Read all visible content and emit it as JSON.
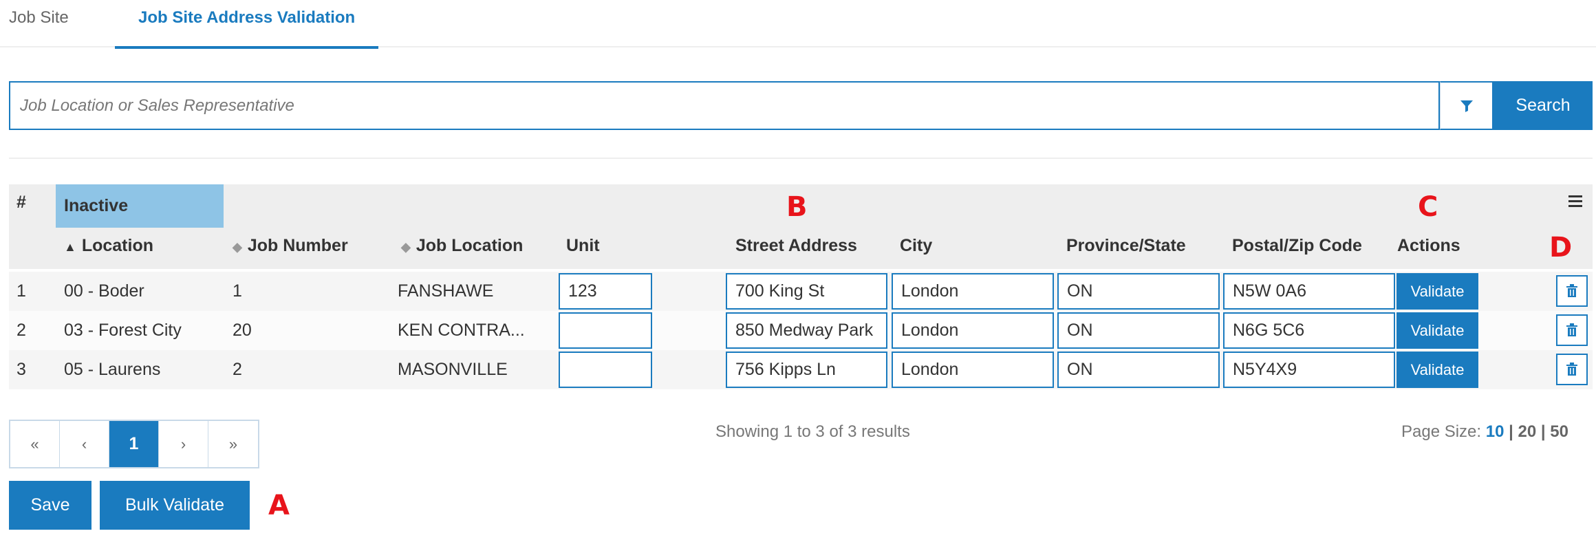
{
  "tabs": [
    {
      "label": "Job Site"
    },
    {
      "label": "Job Site Address Validation"
    }
  ],
  "search": {
    "placeholder": "Job Location or Sales Representative",
    "button_label": "Search",
    "filter_icon": "filter-icon"
  },
  "table": {
    "hash_label": "#",
    "group_label": "Inactive",
    "menu_icon": "hamburger-menu-icon",
    "headers": {
      "location": "Location",
      "job_number": "Job Number",
      "job_location": "Job Location",
      "unit": "Unit",
      "street_address": "Street Address",
      "city": "City",
      "province_state": "Province/State",
      "postal_zip": "Postal/Zip Code",
      "actions": "Actions"
    },
    "rows": [
      {
        "num": "1",
        "location": "00 - Boder",
        "job_number": "1",
        "job_location": "FANSHAWE",
        "unit": "123",
        "street_address": "700 King St",
        "city": "London",
        "province_state": "ON",
        "postal_zip": "N5W 0A6",
        "action_label": "Validate"
      },
      {
        "num": "2",
        "location": "03 - Forest City",
        "job_number": "20",
        "job_location": "KEN CONTRA...",
        "unit": "",
        "street_address": "850 Medway Park",
        "city": "London",
        "province_state": "ON",
        "postal_zip": "N6G 5C6",
        "action_label": "Validate"
      },
      {
        "num": "3",
        "location": "05 - Laurens",
        "job_number": "2",
        "job_location": "MASONVILLE",
        "unit": "",
        "street_address": "756 Kipps Ln",
        "city": "London",
        "province_state": "ON",
        "postal_zip": "N5Y4X9",
        "action_label": "Validate"
      }
    ]
  },
  "pagination": {
    "first": "«",
    "prev": "‹",
    "current": "1",
    "next": "›",
    "last": "»",
    "showing_text": "Showing 1 to 3 of 3 results",
    "page_size_label": "Page Size:",
    "page_size_options": [
      "10",
      "20",
      "50"
    ],
    "page_size_selected": "10",
    "separator": "|"
  },
  "actions": {
    "save_label": "Save",
    "bulk_validate_label": "Bulk Validate"
  },
  "annotations": {
    "a": "A",
    "b": "B",
    "c": "C",
    "d": "D"
  },
  "colors": {
    "accent": "#1a7bbf",
    "inactive_chip": "#8ec4e6",
    "annotation": "#e8141b"
  }
}
